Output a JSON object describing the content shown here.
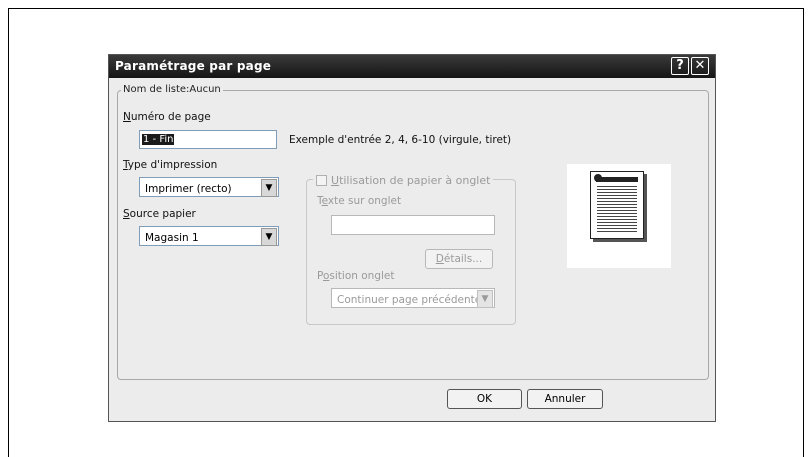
{
  "dialog": {
    "title": "Paramétrage par page",
    "help_label": "?",
    "close_label": "✕",
    "group_label": "Nom de liste:Aucun",
    "page_number": {
      "label_u": "N",
      "label_rest": "uméro de page",
      "value": "1 - Fin",
      "example": "Exemple d'entrée 2, 4, 6-10 (virgule, tiret)"
    },
    "print_type": {
      "label_u": "T",
      "label_rest": "ype d'impression",
      "value": "Imprimer (recto)"
    },
    "paper_source": {
      "label_u": "S",
      "label_rest": "ource papier",
      "value": "Magasin 1"
    },
    "tab_paper": {
      "checkbox_u": "U",
      "checkbox_rest": "tilisation de papier à onglet",
      "text_label_pre": "T",
      "text_label_u": "e",
      "text_label_rest": "xte sur onglet",
      "text_value": "",
      "details_u": "D",
      "details_rest": "étails...",
      "position_pre": "P",
      "position_u": "o",
      "position_rest": "sition onglet",
      "position_value": "Continuer page précédente"
    },
    "ok_label": "OK",
    "cancel_label": "Annuler"
  },
  "icons": {
    "combo_arrow": "chevron-down-icon",
    "close": "close-icon",
    "help": "help-icon"
  }
}
